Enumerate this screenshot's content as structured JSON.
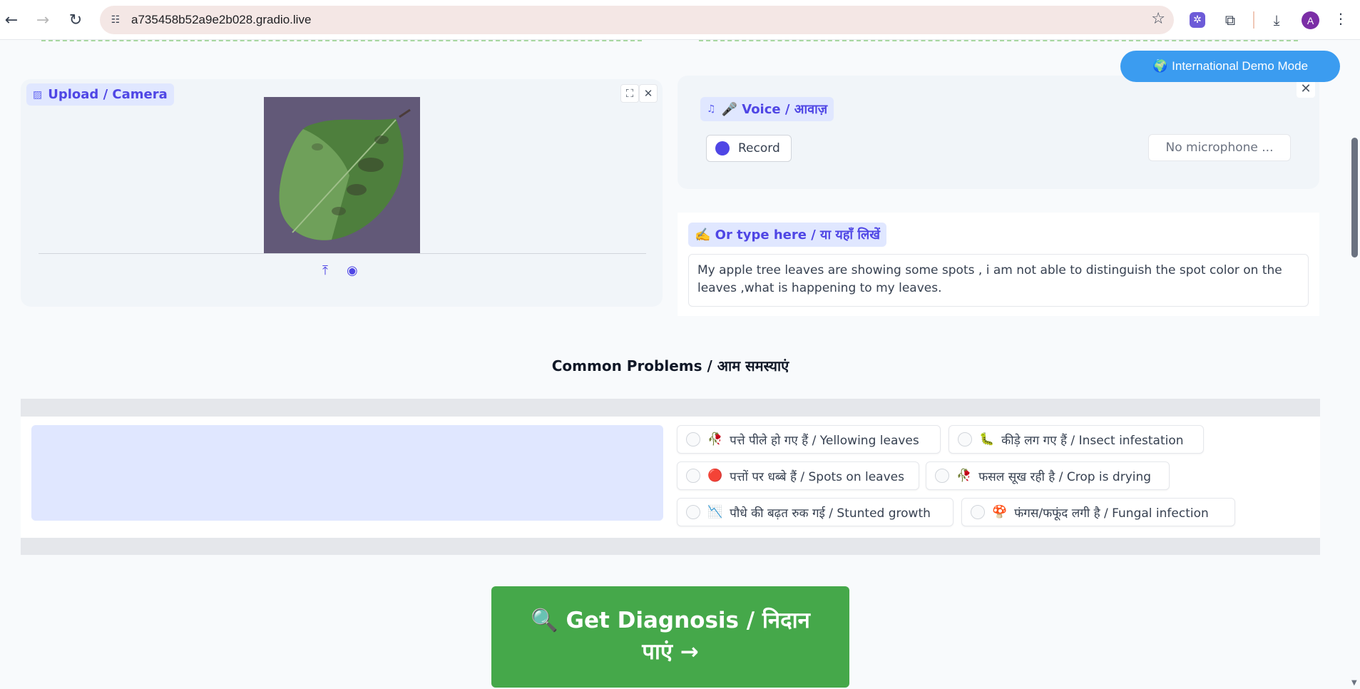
{
  "browser": {
    "url": "a735458b52a9e2b028.gradio.live",
    "avatar_letter": "A"
  },
  "demo_mode": {
    "icon": "🌍",
    "label": "International Demo Mode"
  },
  "upload": {
    "label": "Upload / Camera"
  },
  "voice": {
    "label": "🎤 Voice / आवाज़",
    "record_label": "Record",
    "mic_placeholder": "No microphone ..."
  },
  "text_input": {
    "label": "✍️ Or type here / या यहाँ लिखें",
    "value": "My apple tree leaves are showing some spots , i am not able to distinguish the spot color on the leaves ,what is happening to my leaves."
  },
  "common_problems": {
    "title": "Common Problems / आम समस्याएं",
    "options": [
      {
        "emoji": "🥀",
        "label": "पत्ते पीले हो गए हैं / Yellowing leaves"
      },
      {
        "emoji": "🐛",
        "label": "कीड़े लग गए हैं / Insect infestation"
      },
      {
        "emoji": "🔴",
        "label": "पत्तों पर धब्बे हैं / Spots on leaves"
      },
      {
        "emoji": "🥀",
        "label": "फसल सूख रही है / Crop is drying"
      },
      {
        "emoji": "📉",
        "label": "पौधे की बढ़त रुक गई / Stunted growth"
      },
      {
        "emoji": "🍄",
        "label": "फंगस/फफूंद लगी है / Fungal infection"
      }
    ]
  },
  "diagnose": {
    "line1": "🔍 Get Diagnosis / निदान",
    "line2": "पाएं →"
  },
  "colors": {
    "accent": "#4f46e5",
    "demo_pill": "#3b9cf0",
    "diagnose_button": "#45a84a"
  }
}
